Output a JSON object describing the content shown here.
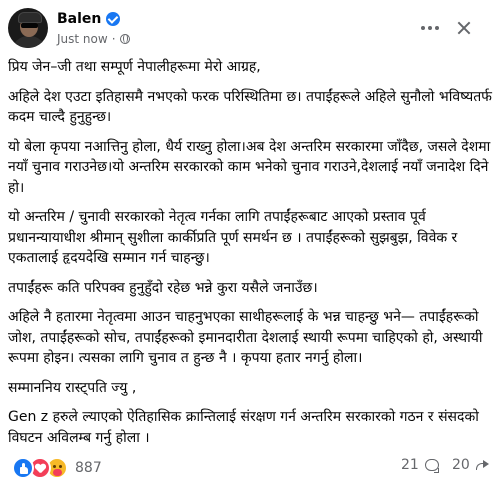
{
  "post": {
    "author": "Balen",
    "time": "Just now",
    "dot": "·",
    "icons": {
      "avatar": "profile-photo",
      "verified": "verified-badge-icon",
      "audience": "globe-icon",
      "more": "more-options-icon",
      "close": "close-icon"
    },
    "paragraphs": [
      "प्रिय जेन–जी तथा सम्पूर्ण नेपालीहरूमा मेरो आग्रह,",
      "अहिले देश एउटा इतिहासमै नभएको फरक परिस्थितिमा छ। तपाईंहरूले अहिले सुनौलो भविष्यतर्फ कदम चाल्दै हुनुहुन्छ।",
      "यो बेला कृपया नआत्तिनु होला, धैर्य राख्नु होला।अब देश अन्तरिम सरकारमा जाँदैछ, जसले देशमा नयाँ चुनाव गराउनेछ।यो अन्तरिम सरकारको काम भनेको चुनाव गराउने,देशलाई नयाँ जनादेश दिने हो।",
      "यो अन्तरिम / चुनावी सरकारको नेतृत्व गर्नका लागि तपाईंहरूबाट आएको प्रस्ताव पूर्व प्रधानन्यायाधीश श्रीमान् सुशीला कार्कीप्रति पूर्ण समर्थन छ । तपाईंहरूको सुझबुझ, विवेक र एकतालाई हृदयदेखि सम्मान गर्न चाहन्छु।",
      "तपाईंहरू कति परिपक्व हुनुहुँदो रहेछ भन्ने कुरा यसैले जनाउँछ।",
      "अहिले नै हतारमा नेतृत्वमा आउन चाहनुभएका साथीहरूलाई के भन्न चाहन्छु भने— तपाईंहरूको जोश, तपाईंहरूको सोच, तपाईंहरूको इमानदारीता  देशलाई स्थायी रूपमा चाहिएको हो, अस्थायी रूपमा होइन। त्यसका लागि चुनाव त हुन्छ नै । कृपया हतार नगर्नु होला।",
      "सम्माननिय रास्ट्पति ज्यु ,",
      "Gen z हरुले ल्याएको ऐतिहासिक क्रान्तिलाई संरक्षण गर्न अन्तरिम सरकारको गठन र संसदको विघटन अविलम्ब गर्नु होला ।"
    ],
    "reactions": {
      "types": [
        "like",
        "love",
        "care"
      ],
      "icons": [
        "like-reaction-icon",
        "love-reaction-icon",
        "care-reaction-icon"
      ],
      "colors": {
        "like": "#1877f2",
        "love": "#f33e58",
        "care": "#f7b928"
      },
      "count": "887"
    },
    "comments": {
      "count": "21",
      "icon": "comment-icon"
    },
    "shares": {
      "count": "20",
      "icon": "share-icon"
    }
  }
}
